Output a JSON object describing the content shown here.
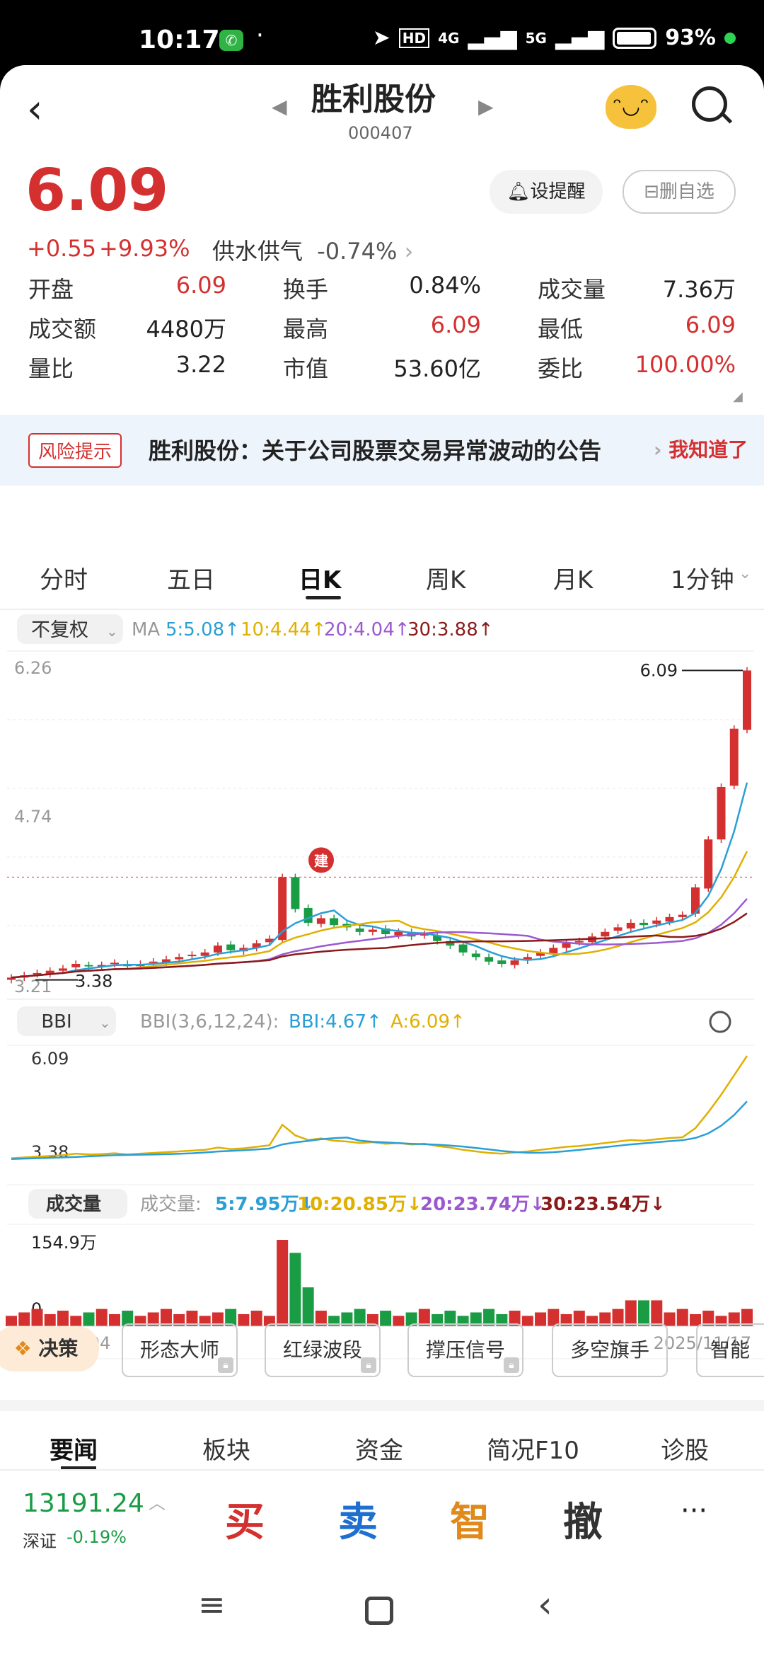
{
  "status": {
    "time": "10:17",
    "right_text": "93%",
    "net1": "4G",
    "net2": "5G",
    "hd": "HD"
  },
  "header": {
    "title": "胜利股份",
    "code": "000407"
  },
  "quote": {
    "price": "6.09",
    "change": "+0.55",
    "change_pct": "+9.93%",
    "sector": "供水供气",
    "sector_pct": "-0.74%",
    "alert_btn": "设提醒",
    "remove_btn": "删自选"
  },
  "stats": [
    {
      "label": "开盘",
      "value": "6.09",
      "tone": "red"
    },
    {
      "label": "换手",
      "value": "0.84%",
      "tone": "dark"
    },
    {
      "label": "成交量",
      "value": "7.36万",
      "tone": "dark"
    },
    {
      "label": "成交额",
      "value": "4480万",
      "tone": "dark"
    },
    {
      "label": "最高",
      "value": "6.09",
      "tone": "red"
    },
    {
      "label": "最低",
      "value": "6.09",
      "tone": "red"
    },
    {
      "label": "量比",
      "value": "3.22",
      "tone": "dark"
    },
    {
      "label": "市值",
      "value": "53.60亿",
      "tone": "dark"
    },
    {
      "label": "委比",
      "value": "100.00%",
      "tone": "red"
    }
  ],
  "risk": {
    "tag": "风险提示",
    "text": "胜利股份：关于公司股票交易异常波动的公告",
    "ack": "我知道了"
  },
  "period_tabs": [
    "分时",
    "五日",
    "日K",
    "周K",
    "月K",
    "1分钟"
  ],
  "kline": {
    "adjust": "不复权",
    "ma_label": "MA",
    "ma5": "5:5.08↑",
    "ma10": "10:4.44↑",
    "ma20": "20:4.04↑",
    "ma30": "30:3.88↑",
    "y_max": "6.26",
    "y_mid": "4.74",
    "y_min": "3.21",
    "low_mark": "3.38",
    "high_mark": "6.09",
    "marker": "建"
  },
  "bbi": {
    "selector": "BBI",
    "params": "BBI(3,6,12,24):",
    "bbi_val": "BBI:4.67↑",
    "a_val": "A:6.09↑",
    "y_max": "6.09",
    "y_min": "3.38"
  },
  "volume": {
    "selector": "成交量",
    "label": "成交量:",
    "v5": "5:7.95万↓",
    "v10": "10:20.85万↓",
    "v20": "20:23.74万↓",
    "v30": "30:23.54万↓",
    "y_max": "154.9万",
    "y_min": "0",
    "date_start": "2025/08/04",
    "date_end": "2025/11/17"
  },
  "tools": {
    "decision": "决策",
    "chips": [
      "形态大师",
      "红绿波段",
      "撑压信号",
      "多空旗手",
      "智能"
    ]
  },
  "bottom_tabs": [
    "要闻",
    "板块",
    "资金",
    "简况F10",
    "诊股"
  ],
  "index": {
    "value": "13191.24",
    "name": "深证",
    "pct": "-0.19%"
  },
  "actions": [
    "买",
    "卖",
    "智",
    "撤",
    "···"
  ],
  "colors": {
    "up": "#d43030",
    "down": "#1a9c45",
    "ma5": "#2a9fd6",
    "ma10": "#e0b000",
    "ma20": "#9b59d0",
    "ma30": "#8b1a1a"
  },
  "chart_data": {
    "type": "candlestick",
    "title": "胜利股份 日K",
    "x": [
      "2025/08/04",
      "2025/11/17"
    ],
    "ylim": [
      3.21,
      6.26
    ],
    "series": [
      {
        "name": "MA5",
        "last": 5.08
      },
      {
        "name": "MA10",
        "last": 4.44
      },
      {
        "name": "MA20",
        "last": 4.04
      },
      {
        "name": "MA30",
        "last": 3.88
      }
    ],
    "closes": [
      3.4,
      3.42,
      3.44,
      3.46,
      3.48,
      3.52,
      3.5,
      3.51,
      3.53,
      3.5,
      3.52,
      3.54,
      3.56,
      3.58,
      3.6,
      3.62,
      3.68,
      3.64,
      3.66,
      3.7,
      3.74,
      4.28,
      4.0,
      3.88,
      3.92,
      3.86,
      3.84,
      3.8,
      3.82,
      3.78,
      3.8,
      3.76,
      3.78,
      3.72,
      3.68,
      3.62,
      3.58,
      3.54,
      3.52,
      3.55,
      3.58,
      3.62,
      3.66,
      3.7,
      3.72,
      3.76,
      3.8,
      3.84,
      3.88,
      3.86,
      3.9,
      3.93,
      3.95,
      4.19,
      4.61,
      5.07,
      5.58,
      6.09
    ]
  }
}
